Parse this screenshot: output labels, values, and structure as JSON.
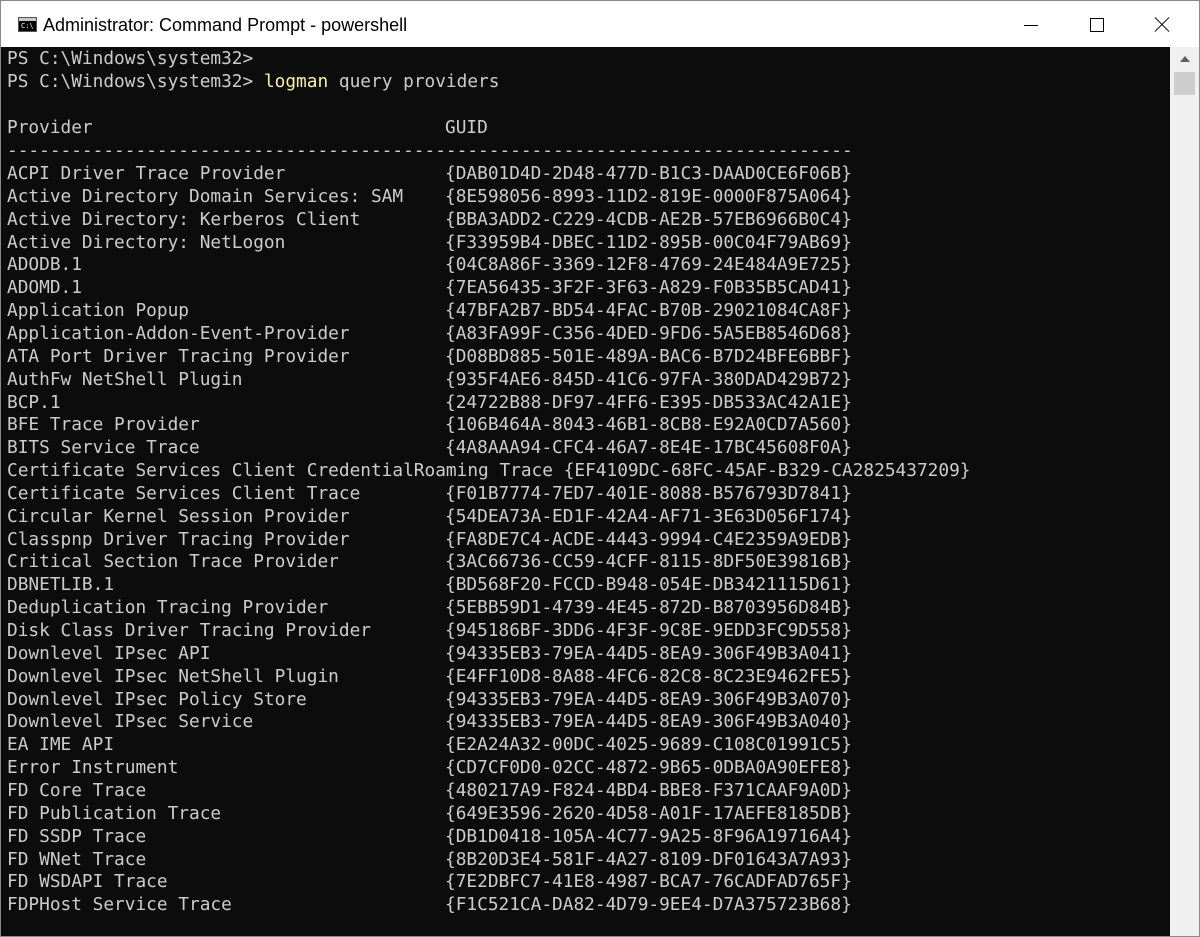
{
  "window": {
    "title": "Administrator: Command Prompt - powershell",
    "icon_text": "C:\\",
    "icon": "cmd-icon"
  },
  "controls": {
    "minimize": "minimize-icon",
    "maximize": "maximize-icon",
    "close": "close-icon"
  },
  "console": {
    "prompt1": "PS C:\\Windows\\system32>",
    "prompt2": "PS C:\\Windows\\system32> ",
    "command_name": "logman",
    "command_args": " query providers",
    "header_provider": "Provider",
    "header_guid": "GUID",
    "separator": "-------------------------------------------------------------------------------",
    "rows": [
      {
        "provider": "ACPI Driver Trace Provider",
        "guid": "{DAB01D4D-2D48-477D-B1C3-DAAD0CE6F06B}"
      },
      {
        "provider": "Active Directory Domain Services: SAM",
        "guid": "{8E598056-8993-11D2-819E-0000F875A064}"
      },
      {
        "provider": "Active Directory: Kerberos Client",
        "guid": "{BBA3ADD2-C229-4CDB-AE2B-57EB6966B0C4}"
      },
      {
        "provider": "Active Directory: NetLogon",
        "guid": "{F33959B4-DBEC-11D2-895B-00C04F79AB69}"
      },
      {
        "provider": "ADODB.1",
        "guid": "{04C8A86F-3369-12F8-4769-24E484A9E725}"
      },
      {
        "provider": "ADOMD.1",
        "guid": "{7EA56435-3F2F-3F63-A829-F0B35B5CAD41}"
      },
      {
        "provider": "Application Popup",
        "guid": "{47BFA2B7-BD54-4FAC-B70B-29021084CA8F}"
      },
      {
        "provider": "Application-Addon-Event-Provider",
        "guid": "{A83FA99F-C356-4DED-9FD6-5A5EB8546D68}"
      },
      {
        "provider": "ATA Port Driver Tracing Provider",
        "guid": "{D08BD885-501E-489A-BAC6-B7D24BFE6BBF}"
      },
      {
        "provider": "AuthFw NetShell Plugin",
        "guid": "{935F4AE6-845D-41C6-97FA-380DAD429B72}"
      },
      {
        "provider": "BCP.1",
        "guid": "{24722B88-DF97-4FF6-E395-DB533AC42A1E}"
      },
      {
        "provider": "BFE Trace Provider",
        "guid": "{106B464A-8043-46B1-8CB8-E92A0CD7A560}"
      },
      {
        "provider": "BITS Service Trace",
        "guid": "{4A8AAA94-CFC4-46A7-8E4E-17BC45608F0A}"
      },
      {
        "provider": "Certificate Services Client CredentialRoaming Trace",
        "guid": "{EF4109DC-68FC-45AF-B329-CA2825437209}"
      },
      {
        "provider": "Certificate Services Client Trace",
        "guid": "{F01B7774-7ED7-401E-8088-B576793D7841}"
      },
      {
        "provider": "Circular Kernel Session Provider",
        "guid": "{54DEA73A-ED1F-42A4-AF71-3E63D056F174}"
      },
      {
        "provider": "Classpnp Driver Tracing Provider",
        "guid": "{FA8DE7C4-ACDE-4443-9994-C4E2359A9EDB}"
      },
      {
        "provider": "Critical Section Trace Provider",
        "guid": "{3AC66736-CC59-4CFF-8115-8DF50E39816B}"
      },
      {
        "provider": "DBNETLIB.1",
        "guid": "{BD568F20-FCCD-B948-054E-DB3421115D61}"
      },
      {
        "provider": "Deduplication Tracing Provider",
        "guid": "{5EBB59D1-4739-4E45-872D-B8703956D84B}"
      },
      {
        "provider": "Disk Class Driver Tracing Provider",
        "guid": "{945186BF-3DD6-4F3F-9C8E-9EDD3FC9D558}"
      },
      {
        "provider": "Downlevel IPsec API",
        "guid": "{94335EB3-79EA-44D5-8EA9-306F49B3A041}"
      },
      {
        "provider": "Downlevel IPsec NetShell Plugin",
        "guid": "{E4FF10D8-8A88-4FC6-82C8-8C23E9462FE5}"
      },
      {
        "provider": "Downlevel IPsec Policy Store",
        "guid": "{94335EB3-79EA-44D5-8EA9-306F49B3A070}"
      },
      {
        "provider": "Downlevel IPsec Service",
        "guid": "{94335EB3-79EA-44D5-8EA9-306F49B3A040}"
      },
      {
        "provider": "EA IME API",
        "guid": "{E2A24A32-00DC-4025-9689-C108C01991C5}"
      },
      {
        "provider": "Error Instrument",
        "guid": "{CD7CF0D0-02CC-4872-9B65-0DBA0A90EFE8}"
      },
      {
        "provider": "FD Core Trace",
        "guid": "{480217A9-F824-4BD4-BBE8-F371CAAF9A0D}"
      },
      {
        "provider": "FD Publication Trace",
        "guid": "{649E3596-2620-4D58-A01F-17AEFE8185DB}"
      },
      {
        "provider": "FD SSDP Trace",
        "guid": "{DB1D0418-105A-4C77-9A25-8F96A19716A4}"
      },
      {
        "provider": "FD WNet Trace",
        "guid": "{8B20D3E4-581F-4A27-8109-DF01643A7A93}"
      },
      {
        "provider": "FD WSDAPI Trace",
        "guid": "{7E2DBFC7-41E8-4987-BCA7-76CADFAD765F}"
      },
      {
        "provider": "FDPHost Service Trace",
        "guid": "{F1C521CA-DA82-4D79-9EE4-D7A375723B68}"
      }
    ]
  },
  "scrollbar": {
    "up": "scroll-up-arrow-icon"
  }
}
